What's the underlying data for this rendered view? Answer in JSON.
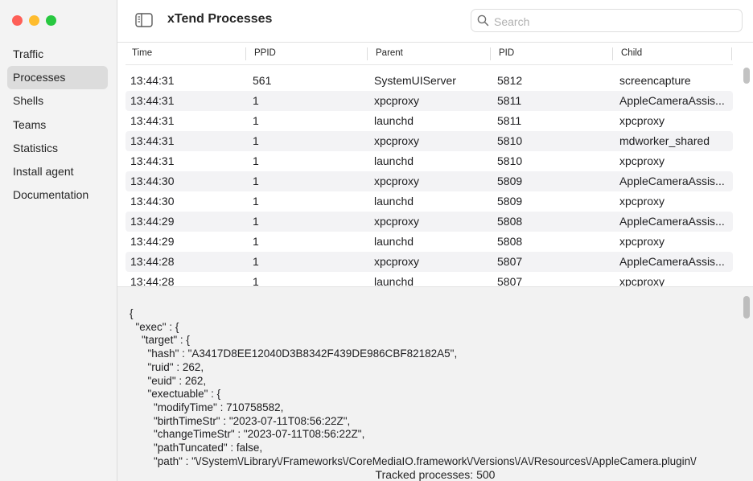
{
  "window": {
    "title": "xTend Processes",
    "traffic_colors": {
      "close": "#fe5f57",
      "minimize": "#febc2e",
      "zoom": "#28c840"
    }
  },
  "sidebar": {
    "items": [
      {
        "label": "Traffic",
        "active": false
      },
      {
        "label": "Processes",
        "active": true
      },
      {
        "label": "Shells",
        "active": false
      },
      {
        "label": "Teams",
        "active": false
      },
      {
        "label": "Statistics",
        "active": false
      },
      {
        "label": "Install agent",
        "active": false
      },
      {
        "label": "Documentation",
        "active": false
      }
    ]
  },
  "search": {
    "placeholder": "Search",
    "value": ""
  },
  "table": {
    "columns": [
      "Time",
      "PPID",
      "Parent",
      "PID",
      "Child"
    ],
    "rows": [
      [
        "13:44:31",
        "561",
        "SystemUIServer",
        "5812",
        "screencapture"
      ],
      [
        "13:44:31",
        "1",
        "xpcproxy",
        "5811",
        "AppleCameraAssis..."
      ],
      [
        "13:44:31",
        "1",
        "launchd",
        "5811",
        "xpcproxy"
      ],
      [
        "13:44:31",
        "1",
        "xpcproxy",
        "5810",
        "mdworker_shared"
      ],
      [
        "13:44:31",
        "1",
        "launchd",
        "5810",
        "xpcproxy"
      ],
      [
        "13:44:30",
        "1",
        "xpcproxy",
        "5809",
        "AppleCameraAssis..."
      ],
      [
        "13:44:30",
        "1",
        "launchd",
        "5809",
        "xpcproxy"
      ],
      [
        "13:44:29",
        "1",
        "xpcproxy",
        "5808",
        "AppleCameraAssis..."
      ],
      [
        "13:44:29",
        "1",
        "launchd",
        "5808",
        "xpcproxy"
      ],
      [
        "13:44:28",
        "1",
        "xpcproxy",
        "5807",
        "AppleCameraAssis..."
      ],
      [
        "13:44:28",
        "1",
        "launchd",
        "5807",
        "xpcproxy"
      ]
    ]
  },
  "detail": {
    "lines": [
      "{",
      "  \"exec\" : {",
      "    \"target\" : {",
      "      \"hash\" : \"A3417D8EE12040D3B8342F439DE986CBF82182A5\",",
      "      \"ruid\" : 262,",
      "      \"euid\" : 262,",
      "      \"exectuable\" : {",
      "        \"modifyTime\" : 710758582,",
      "        \"birthTimeStr\" : \"2023-07-11T08:56:22Z\",",
      "        \"changeTimeStr\" : \"2023-07-11T08:56:22Z\",",
      "        \"pathTuncated\" : false,",
      "        \"path\" : \"\\/System\\/Library\\/Frameworks\\/CoreMediaIO.framework\\/Versions\\/A\\/Resources\\/AppleCamera.plugin\\/"
    ]
  },
  "footer": {
    "label": "Tracked processes: 500"
  }
}
